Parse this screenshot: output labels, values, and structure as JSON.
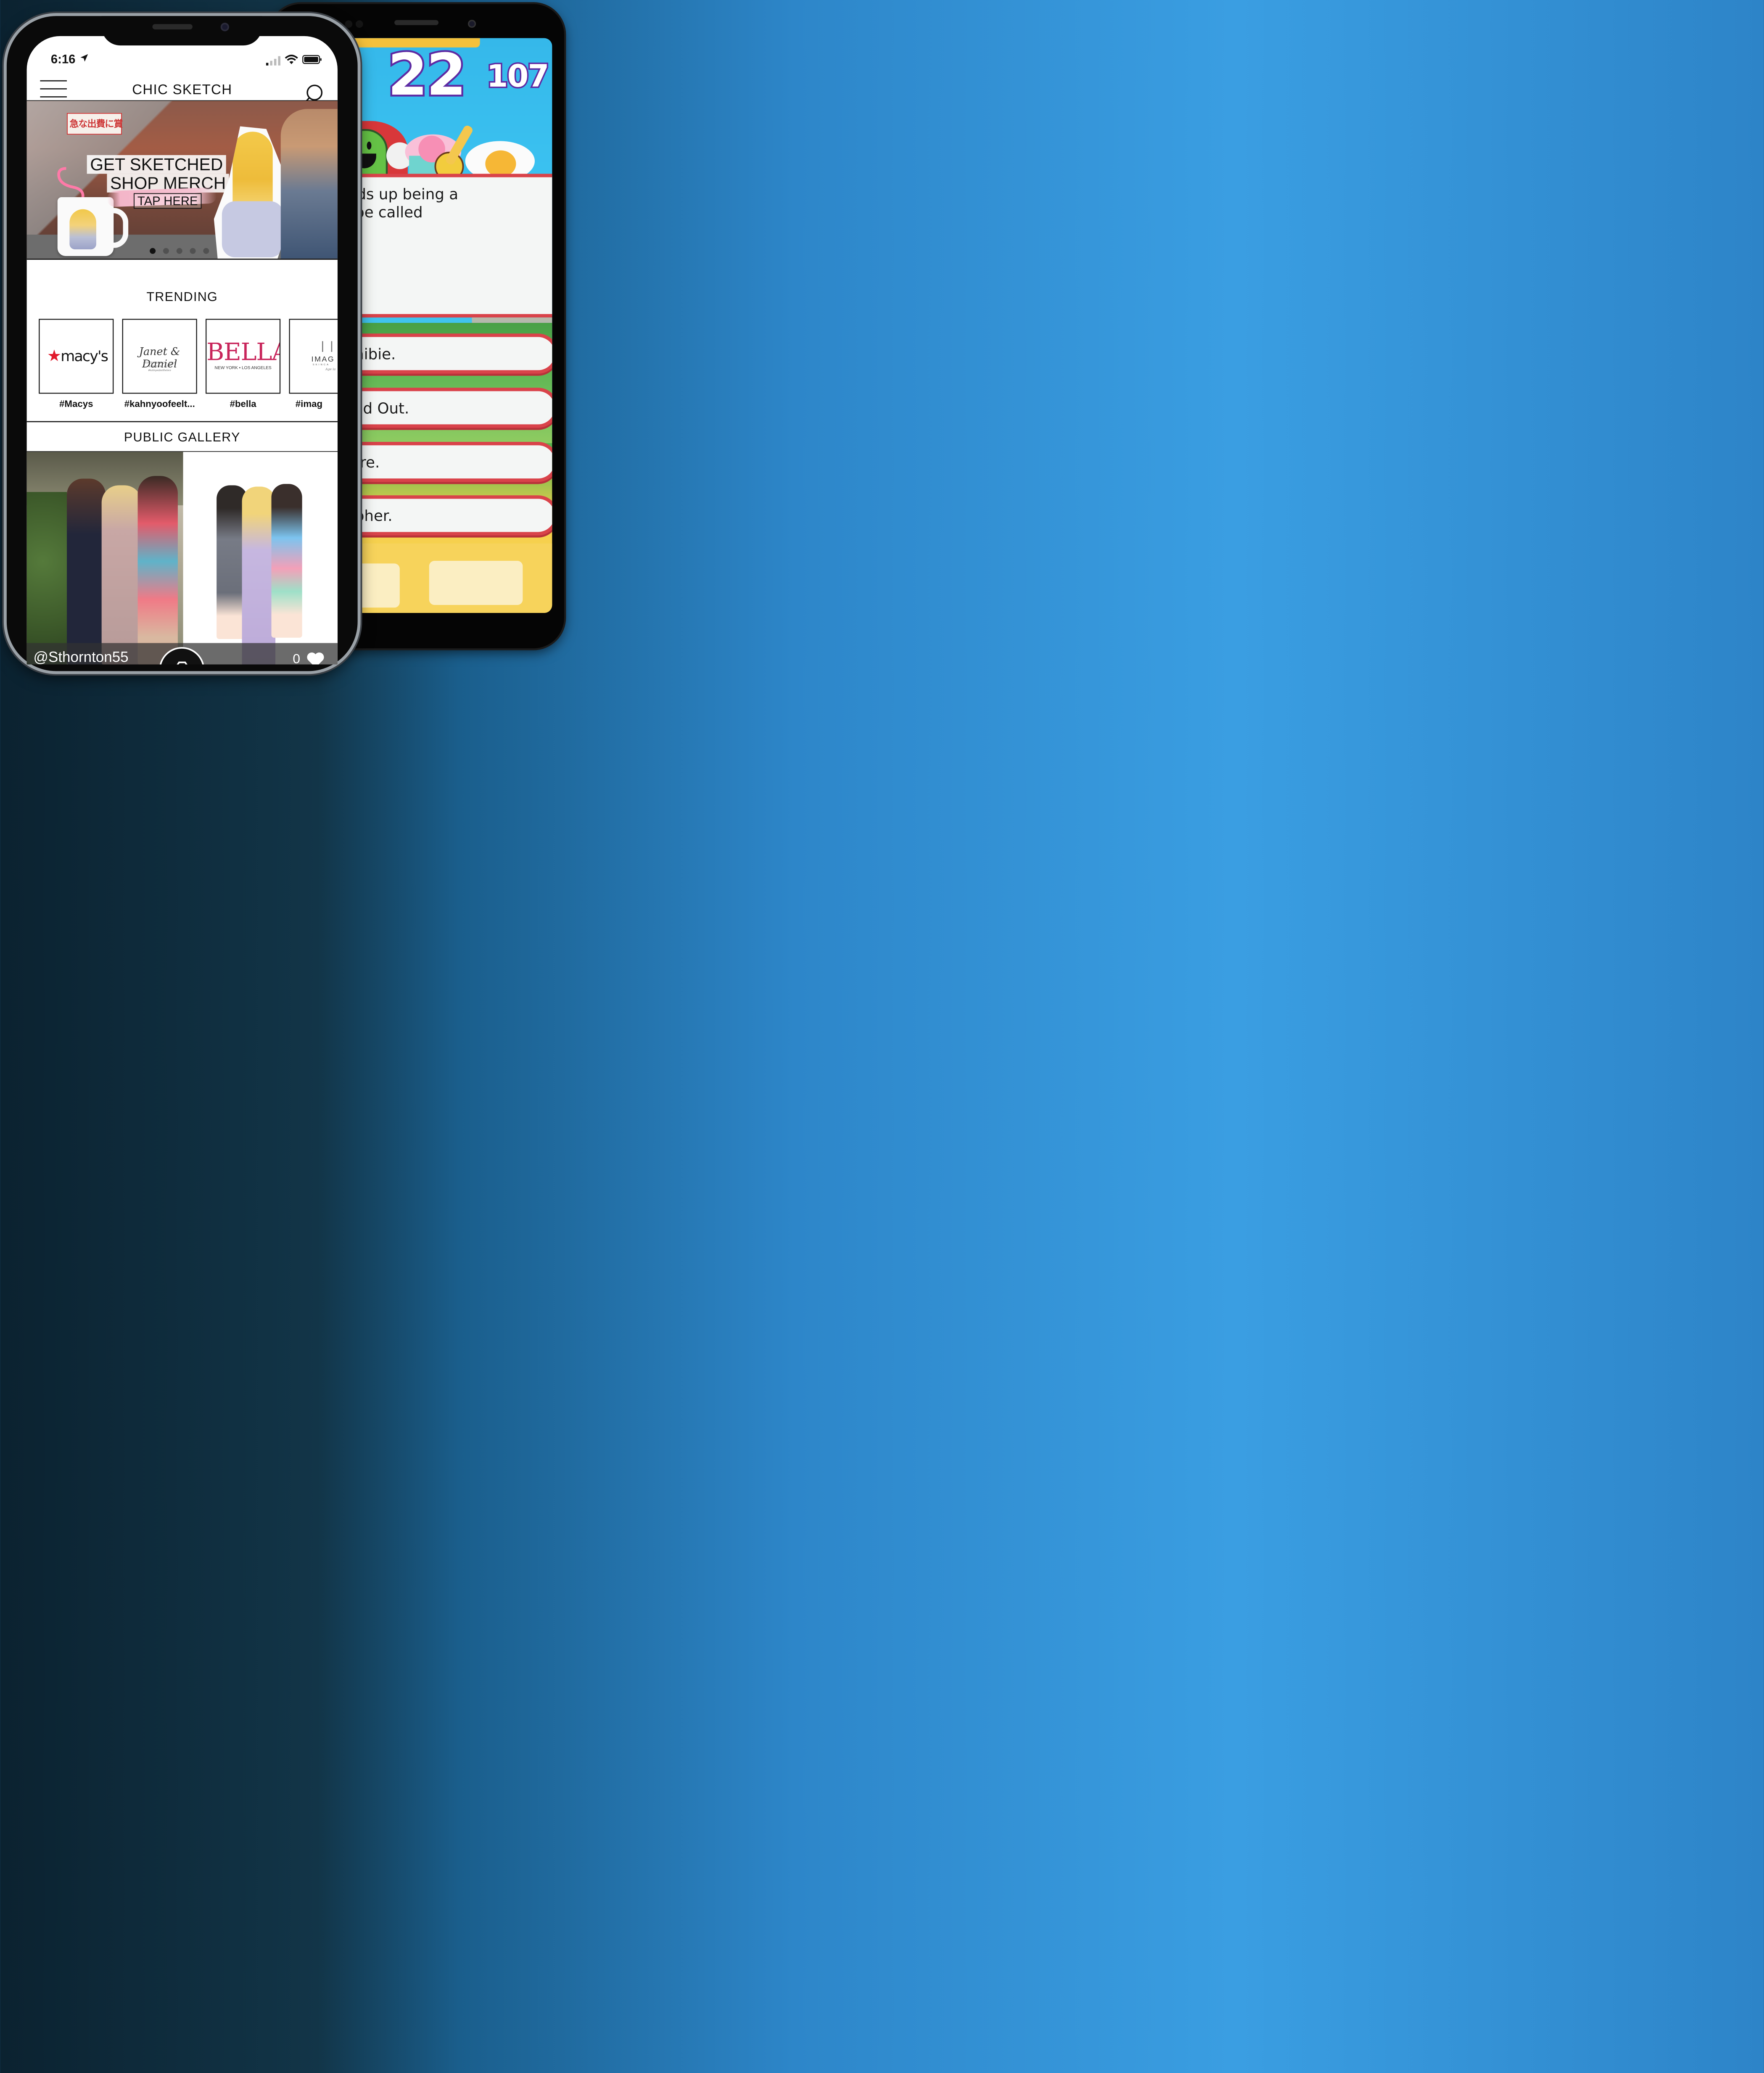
{
  "iphone_app": {
    "status": {
      "time": "6:16"
    },
    "nav": {
      "title": "CHIC SKETCH"
    },
    "hero": {
      "line1": "GET SKETCHED",
      "line2": "SHOP MERCH",
      "cta": "TAP HERE",
      "sign_text": "急な出費に賞",
      "active_slide": 1,
      "slide_count": 5
    },
    "trending": {
      "title": "TRENDING",
      "items": [
        {
          "tag": "#Macys",
          "logo": "macy's"
        },
        {
          "tag": "#kahnyoofeelt...",
          "logo_main": "Janet & Daniel",
          "logo_sub": "SEPTEMBER 22, 2018",
          "logo_sub2": "NEW YORK CITY",
          "logo_sub3": "#kahnyoofeeltheloce"
        },
        {
          "tag": "#bella",
          "logo_main": "BELLA",
          "logo_sub": "NEW YORK • LOS ANGELES"
        },
        {
          "tag": "#imag",
          "logo_main": "IMAG",
          "logo_sub": "SKINCA",
          "logo_sub2": "Age la"
        }
      ]
    },
    "gallery": {
      "title": "PUBLIC GALLERY",
      "user": "@Sthornton55",
      "likes": "0"
    },
    "colors": {
      "macys_red": "#e11a2c",
      "bella_pink": "#c8255b"
    }
  },
  "game": {
    "score": "22",
    "points": "107",
    "question_line1": "that ends up being a",
    "question_line2": "un can be called",
    "answers": [
      "A Wannibie.",
      "An Up And Out.",
      "A Flare.",
      "A Gopher."
    ],
    "colors": {
      "border": "#d9434a",
      "score_outline": "#5e2aa3"
    }
  }
}
